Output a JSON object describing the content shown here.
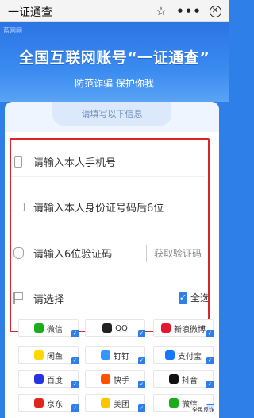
{
  "topbar": {
    "title": "一证通查",
    "icons": [
      "star-icon",
      "more-icon",
      "close-icon"
    ],
    "more_glyph": "•••",
    "star_glyph": "☆",
    "close_glyph": "✕"
  },
  "banner": {
    "brand": "蓝网网",
    "title": "全国互联网账号“一证通查”",
    "slogan": "防范诈骗 保护你我"
  },
  "form": {
    "header": "请填写以下信息",
    "phone_placeholder": "请输入本人手机号",
    "id_placeholder": "请输入本人身份证号码后6位",
    "code_placeholder": "请输入6位验证码",
    "get_code": "获取验证码",
    "select_label": "请选择",
    "select_all": "全选",
    "check_glyph": "✓"
  },
  "platforms": [
    {
      "label": "微信",
      "color": "#1aad19"
    },
    {
      "label": "QQ",
      "color": "#222222"
    },
    {
      "label": "新浪微博",
      "color": "#e6162d"
    },
    {
      "label": "闲鱼",
      "color": "#ffd800"
    },
    {
      "label": "钉钉",
      "color": "#3296fa"
    },
    {
      "label": "支付宝",
      "color": "#1677ff"
    },
    {
      "label": "百度",
      "color": "#2932e1"
    },
    {
      "label": "快手",
      "color": "#ff5000"
    },
    {
      "label": "抖音",
      "color": "#111111"
    },
    {
      "label": "京东",
      "color": "#e1251b"
    },
    {
      "label": "美团",
      "color": "#ffc300"
    },
    {
      "label": "微信",
      "color": "#1aad19"
    }
  ],
  "watermark": "全民反诈",
  "colors": {
    "accent": "#2f7fe8",
    "highlight_box": "#d6262b"
  }
}
